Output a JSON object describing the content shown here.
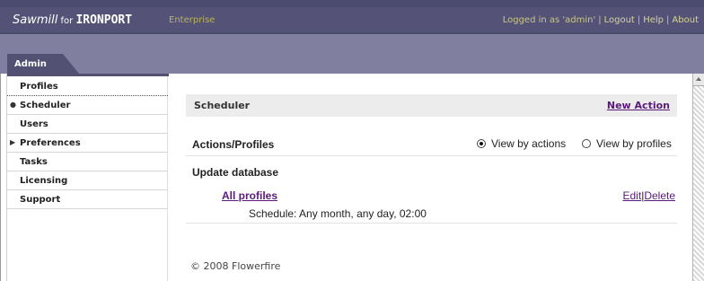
{
  "header": {
    "brand_part1": "Sawmill",
    "brand_part2": " for ",
    "brand_part3": "IRONPORT",
    "edition": "Enterprise",
    "logged_in": "Logged in as 'admin'",
    "logout": "Logout",
    "help": "Help",
    "about": "About"
  },
  "tab": {
    "label": "Admin"
  },
  "sidebar": {
    "items": [
      {
        "label": "Profiles",
        "marker": ""
      },
      {
        "label": "Scheduler",
        "marker": "●"
      },
      {
        "label": "Users",
        "marker": ""
      },
      {
        "label": "Preferences",
        "marker": "▶"
      },
      {
        "label": "Tasks",
        "marker": ""
      },
      {
        "label": "Licensing",
        "marker": ""
      },
      {
        "label": "Support",
        "marker": ""
      }
    ]
  },
  "main": {
    "title": "Scheduler",
    "new_action": "New Action",
    "actions_label": "Actions/Profiles",
    "view_by_actions": "View by actions",
    "view_by_profiles": "View by profiles",
    "selected_view": "actions",
    "action_name": "Update database",
    "profile_link": "All profiles",
    "edit": "Edit",
    "delete": "Delete",
    "separator": "|",
    "schedule": "Schedule: Any month, any day, 02:00"
  },
  "footer": {
    "copyright": "© 2008 Flowerfire"
  }
}
